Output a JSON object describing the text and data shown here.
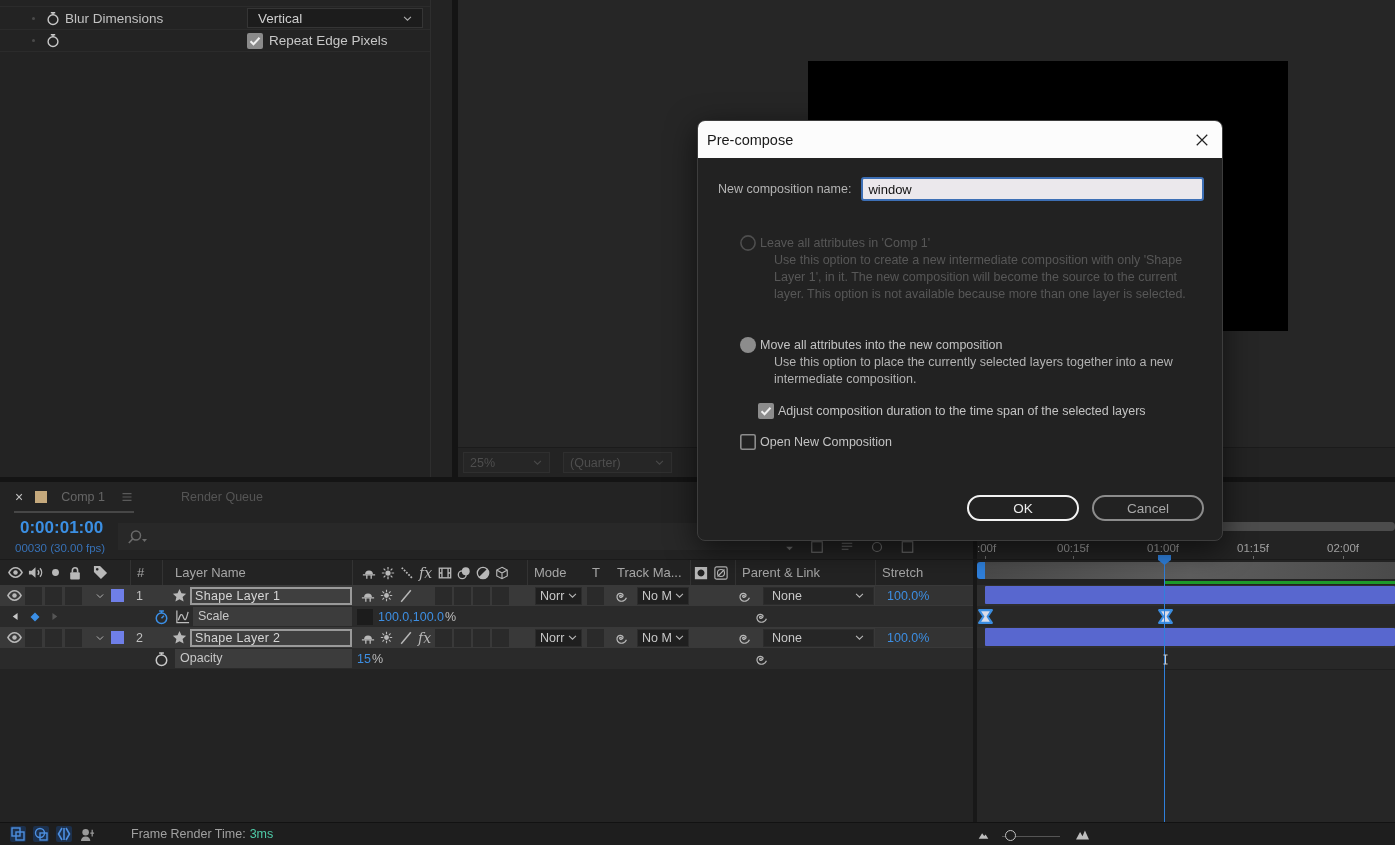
{
  "effect_controls": {
    "rows": [
      {
        "kind": "dropdown",
        "name": "Blur Dimensions",
        "value": "Vertical"
      },
      {
        "kind": "checkbox",
        "label": "Repeat Edge Pixels",
        "checked": true
      }
    ]
  },
  "viewer": {
    "zoom": "25%",
    "resolution": "(Quarter)"
  },
  "timeline": {
    "tabs": [
      {
        "close": "×",
        "color": "#c5a97c",
        "label": "Comp 1",
        "selected": true
      },
      {
        "label": "Render Queue",
        "selected": false
      }
    ],
    "time": "0:00:01:00",
    "frame_info": "00030 (30.00 fps)",
    "columns": {
      "number": "#",
      "layer_name": "Layer Name",
      "effects": "fx",
      "mode": "Mode",
      "track_type": "T",
      "track_matte": "Track Ma...",
      "parent": "Parent & Link",
      "stretch": "Stretch"
    },
    "ruler": [
      ":00f",
      "00:15f",
      "01:00f",
      "01:15f",
      "02:00f"
    ],
    "layers": [
      {
        "number": "1",
        "name": "Shape Layer 1",
        "color": "#6f7fe8",
        "selected": true,
        "expanded": true,
        "visible": true,
        "mode": "Norr",
        "track_matte": "No M",
        "parent": "None",
        "stretch": "100.0%",
        "children": [
          {
            "name": "Scale",
            "value": "100.0,100.0",
            "unit": "%",
            "animated": true,
            "constrain_proportions": true
          }
        ]
      },
      {
        "number": "2",
        "name": "Shape Layer 2",
        "color": "#6f7fe8",
        "selected": true,
        "expanded": true,
        "visible": true,
        "effects": "fx",
        "mode": "Norr",
        "track_matte": "No M",
        "parent": "None",
        "stretch": "100.0%",
        "children": [
          {
            "name": "Opacity",
            "value": "15",
            "unit": "%",
            "animated": false
          }
        ]
      }
    ]
  },
  "dialog": {
    "title": "Pre-compose",
    "name_field": {
      "label": "New composition name:",
      "value": "window"
    },
    "options": [
      {
        "kind": "radio",
        "label": "Leave all attributes in 'Comp 1'",
        "description": "Use this option to create a new intermediate composition with only 'Shape Layer 1', in it. The new composition will become the source to the current layer. This option is not available because more than one layer is selected.",
        "selected": false,
        "disabled": true
      },
      {
        "kind": "radio",
        "label": "Move all attributes into the new composition",
        "description": "Use this option to place the currently selected layers together into a new intermediate composition.",
        "selected": true,
        "disabled": false,
        "children": [
          {
            "kind": "checkbox",
            "label": "Adjust composition duration to the time span of the selected layers",
            "checked": true,
            "disabled": false
          }
        ]
      },
      {
        "kind": "checkbox",
        "label": "Open New Composition",
        "checked": false,
        "disabled": false
      }
    ],
    "buttons": [
      {
        "label": "OK",
        "default": true
      },
      {
        "label": "Cancel",
        "default": false
      }
    ]
  },
  "status_bar": {
    "label": "Frame Render Time:",
    "value": "3ms",
    "zoom_slider": {
      "level": 0.05
    }
  }
}
